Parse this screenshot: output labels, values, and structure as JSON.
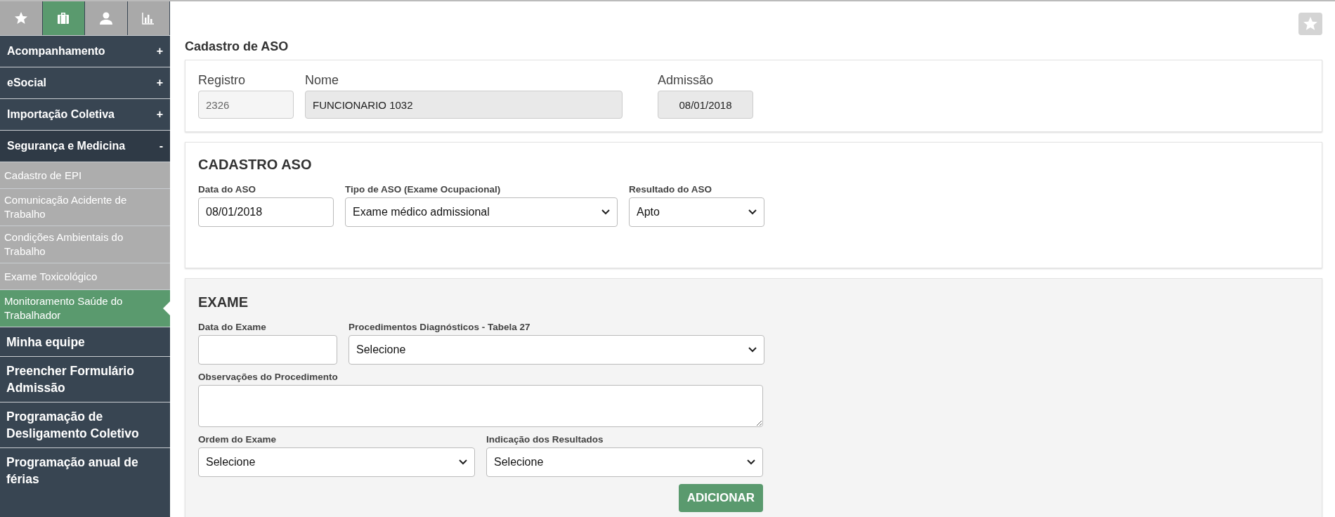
{
  "sidebar": {
    "tabs": [
      {
        "kind": "star",
        "selected": false
      },
      {
        "kind": "briefcase",
        "selected": true
      },
      {
        "kind": "person",
        "selected": false
      },
      {
        "kind": "chart",
        "selected": false
      }
    ],
    "items": [
      {
        "kind": "section",
        "label": "Acompanhamento",
        "toggle": "+",
        "expanded": false,
        "selected": false
      },
      {
        "kind": "section",
        "label": "eSocial",
        "toggle": "+",
        "expanded": false,
        "selected": false
      },
      {
        "kind": "section",
        "label": "Importação Coletiva",
        "toggle": "+",
        "expanded": false,
        "selected": false
      },
      {
        "kind": "section",
        "label": "Segurança e Medicina",
        "toggle": "-",
        "expanded": true,
        "selected": false
      },
      {
        "kind": "subitem",
        "label": "Cadastro de EPI",
        "selected": false
      },
      {
        "kind": "subitem",
        "label": "Comunicação Acidente de Trabalho",
        "selected": false
      },
      {
        "kind": "subitem",
        "label": "Condições Ambientais do Trabalho",
        "selected": false
      },
      {
        "kind": "subitem",
        "label": "Exame Toxicológico",
        "selected": false
      },
      {
        "kind": "subitem",
        "label": "Monitoramento Saúde do Trabalhador",
        "selected": true
      },
      {
        "kind": "link",
        "label": "Minha equipe",
        "selected": false
      },
      {
        "kind": "link",
        "label": "Preencher Formulário Admissão",
        "selected": false
      },
      {
        "kind": "link",
        "label": "Programação de Desligamento Coletivo",
        "selected": false
      },
      {
        "kind": "link",
        "label": "Programação anual de férias",
        "selected": false
      }
    ]
  },
  "page": {
    "title": "Cadastro de ASO",
    "favorite": false
  },
  "employee": {
    "fields": [
      {
        "label": "Registro",
        "value": "2326"
      },
      {
        "label": "Nome",
        "value": "FUNCIONARIO 1032"
      },
      {
        "label": "Admissão",
        "value": "08/01/2018"
      }
    ]
  },
  "aso": {
    "title": "CADASTRO ASO",
    "fields": [
      {
        "kind": "input",
        "label": "Data do ASO",
        "value": "08/01/2018"
      },
      {
        "kind": "select",
        "label": "Tipo de ASO (Exame Ocupacional)",
        "value": "Exame médico admissional"
      },
      {
        "kind": "select",
        "label": "Resultado do ASO",
        "value": "Apto"
      }
    ]
  },
  "exame": {
    "title": "EXAME",
    "rows": [
      [
        {
          "kind": "input",
          "label": "Data do Exame"
        },
        {
          "kind": "select",
          "label": "Procedimentos Diagnósticos - Tabela 27",
          "value": "Selecione"
        }
      ],
      [
        {
          "kind": "textarea",
          "label": "Observações do Procedimento"
        }
      ],
      [
        {
          "kind": "select",
          "label": "Ordem do Exame",
          "value": "Selecione"
        },
        {
          "kind": "select",
          "label": "Indicação dos Resultados",
          "value": "Selecione"
        }
      ]
    ],
    "button": "ADICIONAR"
  }
}
